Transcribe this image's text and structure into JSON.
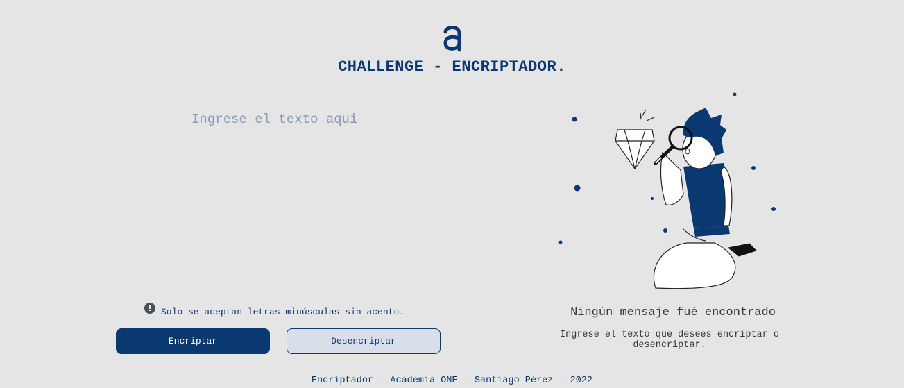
{
  "header": {
    "logo_icon": "alura-a-logo",
    "title": "CHALLENGE - ENCRIPTADOR."
  },
  "input": {
    "placeholder": "Ingrese el texto aqui",
    "value": ""
  },
  "warning": {
    "icon": "exclamation-circle-icon",
    "text": "Solo se aceptan letras minúsculas sin acento."
  },
  "buttons": {
    "encrypt_label": "Encriptar",
    "decrypt_label": "Desencriptar"
  },
  "output": {
    "illustration": "person-with-magnifying-glass-and-diamond",
    "empty_title": "Ningún mensaje fué encontrado",
    "empty_subtitle": "Ingrese el texto que desees encriptar o desencriptar."
  },
  "footer": {
    "text": "Encriptador - Academia ONE - Santiago Pérez - 2022"
  },
  "colors": {
    "primary": "#0a3871",
    "background": "#e5e5e5",
    "secondary_button_bg": "#d8dfe8"
  }
}
